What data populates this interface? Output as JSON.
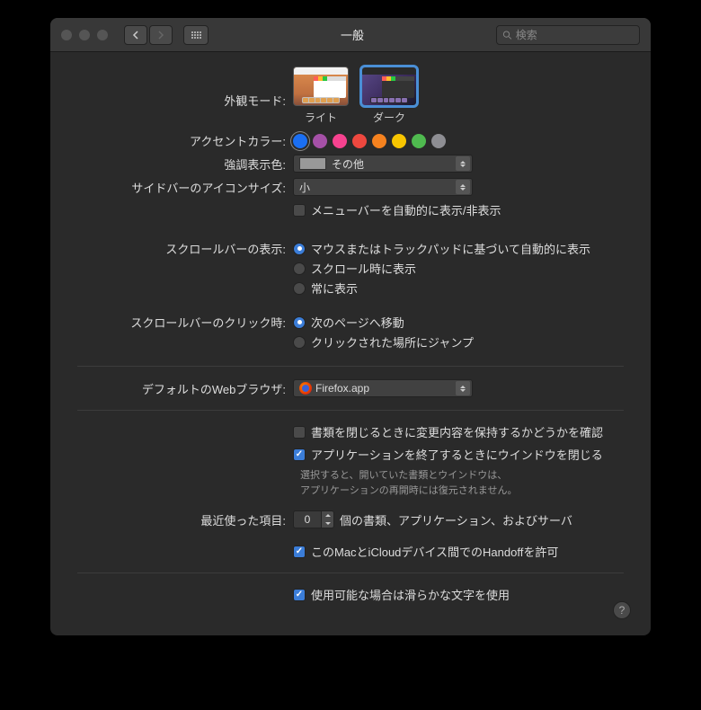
{
  "window": {
    "title": "一般",
    "search_placeholder": "検索"
  },
  "appearance": {
    "label": "外観モード:",
    "light": "ライト",
    "dark": "ダーク",
    "selected": "dark"
  },
  "accent": {
    "label": "アクセントカラー:",
    "colors": [
      "#1b6ff2",
      "#a550a7",
      "#f6428f",
      "#ee483f",
      "#f5821f",
      "#f8c500",
      "#4fba4f",
      "#8e8e93"
    ],
    "selected_index": 0
  },
  "highlight": {
    "label": "強調表示色:",
    "value": "その他"
  },
  "sidebar_icon": {
    "label": "サイドバーのアイコンサイズ:",
    "value": "小"
  },
  "menubar_autohide": {
    "label": "メニューバーを自動的に表示/非表示",
    "checked": false
  },
  "scrollbar_show": {
    "label": "スクロールバーの表示:",
    "options": [
      "マウスまたはトラックパッドに基づいて自動的に表示",
      "スクロール時に表示",
      "常に表示"
    ],
    "selected": 0
  },
  "scrollbar_click": {
    "label": "スクロールバーのクリック時:",
    "options": [
      "次のページへ移動",
      "クリックされた場所にジャンプ"
    ],
    "selected": 0
  },
  "default_browser": {
    "label": "デフォルトのWebブラウザ:",
    "value": "Firefox.app"
  },
  "ask_save": {
    "label": "書類を閉じるときに変更内容を保持するかどうかを確認",
    "checked": false
  },
  "close_windows_on_quit": {
    "label": "アプリケーションを終了するときにウインドウを閉じる",
    "checked": true,
    "note1": "選択すると、開いていた書類とウインドウは、",
    "note2": "アプリケーションの再開時には復元されません。"
  },
  "recent_items": {
    "label": "最近使った項目:",
    "value": "0",
    "suffix": "個の書類、アプリケーション、およびサーバ"
  },
  "handoff": {
    "label": "このMacとiCloudデバイス間でのHandoffを許可",
    "checked": true
  },
  "font_smoothing": {
    "label": "使用可能な場合は滑らかな文字を使用",
    "checked": true
  }
}
